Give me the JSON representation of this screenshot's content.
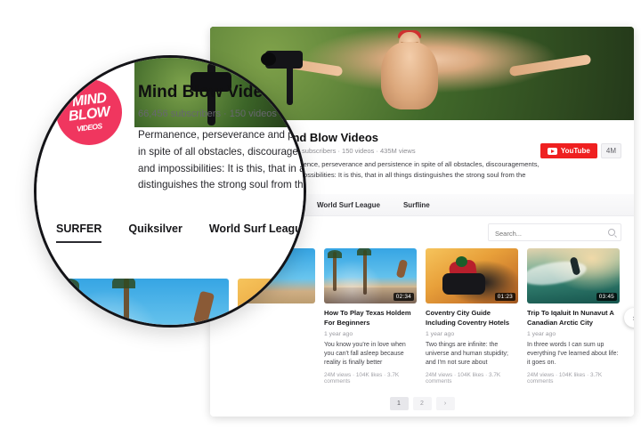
{
  "channel": {
    "name": "Mind Blow Videos",
    "avatar_logo_line1": "MIND",
    "avatar_logo_line2": "BLOW",
    "avatar_logo_line3": "VIDEOS",
    "stats": "66,456 subscribers  ·  150 videos  ·  435M views",
    "stats_short": "66,456 subscribers  ·  150 videos",
    "description_line1": "Permanence, perseverance and persistence in spite of all obstacles, discouragements,",
    "description_line2": "and impossibilities: It is this, that in all things distinguishes the strong soul from the weak.",
    "subscribe_label": "YouTube",
    "subscribe_count": "4M",
    "accent_color": "#ef2020",
    "avatar_color": "#f0365f"
  },
  "tabs": [
    {
      "label": "SURFER",
      "active": true
    },
    {
      "label": "Quiksilver",
      "active": false
    },
    {
      "label": "World Surf League",
      "active": false
    },
    {
      "label": "Surfline",
      "active": false
    }
  ],
  "search": {
    "placeholder": "Search...",
    "value": "",
    "icon": "search-icon"
  },
  "videos": [
    {
      "title": "How To Play Texas Holdem For Beginners",
      "duration": "02:34",
      "age": "1 year ago",
      "description": "You know you're in love when you can't fall asleep because reality is finally better",
      "stats": "24M views  ·  104K likes  ·  3.7K comments"
    },
    {
      "title": "Coventry City Guide Including Coventry Hotels",
      "duration": "01:23",
      "age": "1 year ago",
      "description": "Two things are infinite: the universe and human stupidity; and I'm not sure about",
      "stats": "24M views  ·  104K likes  ·  3.7K comments"
    },
    {
      "title": "Trip To Iqaluit In Nunavut A Canadian Arctic City",
      "duration": "03:45",
      "age": "1 year ago",
      "description": "In three words I can sum up everything I've learned about life: it goes on.",
      "stats": "24M views  ·  104K likes  ·  3.7K comments"
    }
  ],
  "carousel": {
    "next_icon": "chevron-right-icon",
    "next_label": "›"
  },
  "pagination": {
    "pages": [
      "1",
      "2"
    ],
    "active": "1",
    "next_label": "›"
  }
}
